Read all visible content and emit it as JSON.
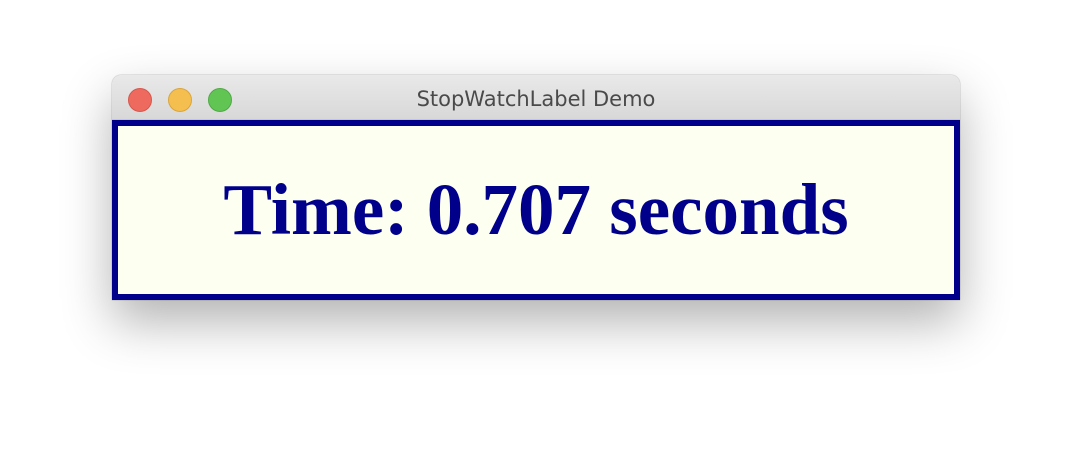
{
  "window": {
    "title": "StopWatchLabel Demo"
  },
  "stopwatch": {
    "label_text": "Time: 0.707 seconds",
    "elapsed_seconds": 0.707
  },
  "colors": {
    "text": "#00008b",
    "border": "#00008b",
    "background": "#fdfff0"
  }
}
